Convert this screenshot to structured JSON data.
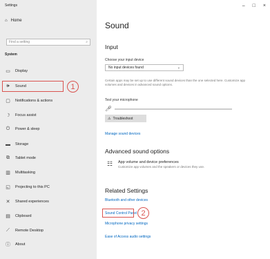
{
  "app_title": "Settings",
  "sidebar": {
    "home_label": "Home",
    "search_placeholder": "Find a setting",
    "section_label": "System",
    "items": [
      {
        "label": "Display",
        "icon": "monitor-icon"
      },
      {
        "label": "Sound",
        "icon": "speaker-icon"
      },
      {
        "label": "Notifications & actions",
        "icon": "notification-icon"
      },
      {
        "label": "Focus assist",
        "icon": "moon-icon"
      },
      {
        "label": "Power & sleep",
        "icon": "power-icon"
      },
      {
        "label": "Storage",
        "icon": "storage-icon"
      },
      {
        "label": "Tablet mode",
        "icon": "tablet-icon"
      },
      {
        "label": "Multitasking",
        "icon": "multitasking-icon"
      },
      {
        "label": "Projecting to this PC",
        "icon": "projector-icon"
      },
      {
        "label": "Shared experiences",
        "icon": "shared-icon"
      },
      {
        "label": "Clipboard",
        "icon": "clipboard-icon"
      },
      {
        "label": "Remote Desktop",
        "icon": "remote-icon"
      },
      {
        "label": "About",
        "icon": "info-icon"
      }
    ]
  },
  "annotations": {
    "one": "1",
    "two": "2",
    "color": "#d9534f"
  },
  "window_controls": {
    "minimize": "–",
    "maximize": "□",
    "close": "×"
  },
  "main": {
    "title": "Sound",
    "input_heading": "Input",
    "choose_input_label": "Choose your input device",
    "input_device_value": "No input devices found",
    "input_desc": "Certain apps may be set up to use different sound devices than the one selected here. Customize app volumes and devices in advanced sound options.",
    "test_mic_label": "Test your microphone",
    "troubleshoot_label": "Troubleshoot",
    "manage_devices_link": "Manage sound devices",
    "advanced_heading": "Advanced sound options",
    "app_volume_title": "App volume and device preferences",
    "app_volume_sub": "Customize app volumes and the speakers or devices they use.",
    "related_heading": "Related Settings",
    "related_links": [
      "Bluetooth and other devices",
      "Sound Control Panel",
      "Microphone privacy settings",
      "Ease of Access audio settings"
    ],
    "link_color": "#0067c0"
  }
}
